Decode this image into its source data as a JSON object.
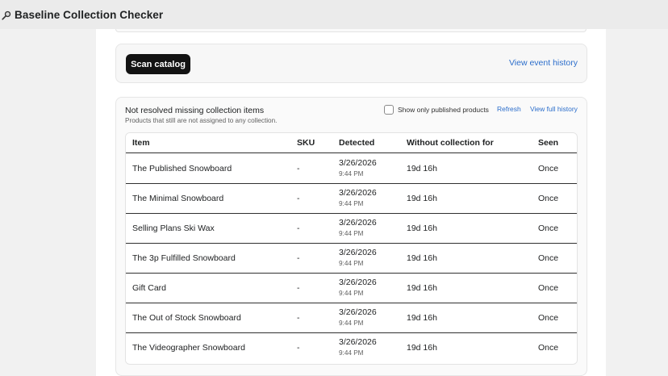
{
  "app": {
    "title": "Baseline Collection Checker",
    "icon": "magnifier-icon"
  },
  "scan_card": {
    "scan_button_label": "Scan catalog",
    "event_history_link": "View event history"
  },
  "items_card": {
    "title": "Not resolved missing collection items",
    "subtitle": "Products that still are not assigned to any collection.",
    "published_only_label": "Show only published products",
    "published_only_checked": false,
    "refresh_label": "Refresh",
    "full_history_label": "View full history"
  },
  "table": {
    "headers": {
      "item": "Item",
      "sku": "SKU",
      "detected": "Detected",
      "without": "Without collection for",
      "seen": "Seen"
    },
    "rows": [
      {
        "item": "The Published Snowboard",
        "sku": "-",
        "date": "3/26/2026",
        "time": "9:44 PM",
        "without": "19d 16h",
        "seen": "Once"
      },
      {
        "item": "The Minimal Snowboard",
        "sku": "-",
        "date": "3/26/2026",
        "time": "9:44 PM",
        "without": "19d 16h",
        "seen": "Once"
      },
      {
        "item": "Selling Plans Ski Wax",
        "sku": "-",
        "date": "3/26/2026",
        "time": "9:44 PM",
        "without": "19d 16h",
        "seen": "Once"
      },
      {
        "item": "The 3p Fulfilled Snowboard",
        "sku": "-",
        "date": "3/26/2026",
        "time": "9:44 PM",
        "without": "19d 16h",
        "seen": "Once"
      },
      {
        "item": "Gift Card",
        "sku": "-",
        "date": "3/26/2026",
        "time": "9:44 PM",
        "without": "19d 16h",
        "seen": "Once"
      },
      {
        "item": "The Out of Stock Snowboard",
        "sku": "-",
        "date": "3/26/2026",
        "time": "9:44 PM",
        "without": "19d 16h",
        "seen": "Once"
      },
      {
        "item": "The Videographer Snowboard",
        "sku": "-",
        "date": "3/26/2026",
        "time": "9:44 PM",
        "without": "19d 16h",
        "seen": "Once"
      }
    ]
  }
}
